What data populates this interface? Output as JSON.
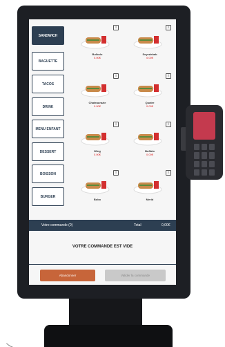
{
  "sidebar": {
    "categories": [
      {
        "label": "SANDWICH",
        "active": true
      },
      {
        "label": "BAGUETTE",
        "active": false
      },
      {
        "label": "TACOS",
        "active": false
      },
      {
        "label": "DRINK",
        "active": false
      },
      {
        "label": "MENU ENFANT",
        "active": false
      },
      {
        "label": "DESSERT",
        "active": false
      },
      {
        "label": "BOISSON",
        "active": false
      },
      {
        "label": "BURGER",
        "active": false
      }
    ]
  },
  "products": [
    {
      "name": "Bulbulo",
      "price": "0.00€"
    },
    {
      "name": "Seyedebab",
      "price": "0.00€"
    },
    {
      "name": "Chateaurazie",
      "price": "0.00€"
    },
    {
      "name": "Quatre",
      "price": "0.00€"
    },
    {
      "name": "Wing",
      "price": "0.00€"
    },
    {
      "name": "Buffalo",
      "price": "0.00€"
    },
    {
      "name": "Bobo",
      "price": ""
    },
    {
      "name": "Merid",
      "price": ""
    }
  ],
  "order": {
    "label": "Votre commande (0)",
    "total_label": "Total",
    "total_value": "0,00€",
    "empty_message": "VOTRE COMMANDE EST VIDE"
  },
  "actions": {
    "abandon_label": "Abandonner",
    "validate_label": "Valider la commande"
  },
  "colors": {
    "accent": "#2d3f52",
    "abandon": "#c7653a",
    "disabled": "#c9c9c9",
    "price": "#dd2222"
  }
}
